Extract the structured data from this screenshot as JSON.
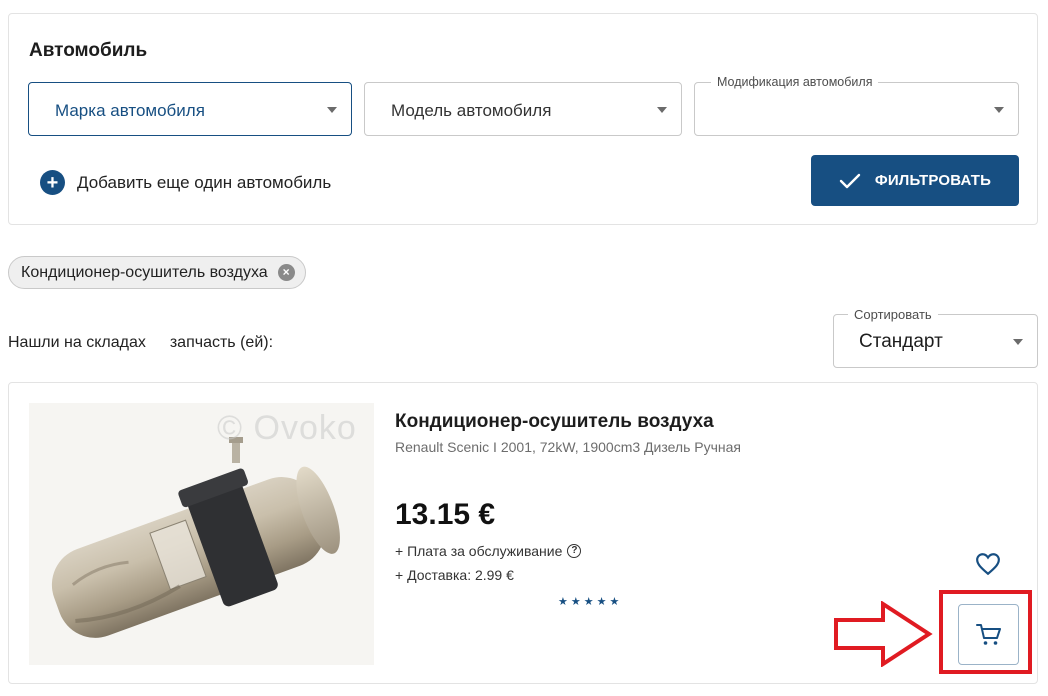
{
  "car_filter": {
    "title": "Автомобиль",
    "brand_placeholder": "Марка автомобиля",
    "model_placeholder": "Модель автомобиля",
    "modification_label": "Модификация автомобиля",
    "modification_value": "",
    "add_car_label": "Добавить еще один автомобиль",
    "filter_button_label": "ФИЛЬТРОВАТЬ"
  },
  "chip": {
    "label": "Кондиционер-осушитель воздуха"
  },
  "results": {
    "found_prefix": "Нашли на складах",
    "found_suffix": "запчасть (ей):"
  },
  "sort": {
    "label": "Сортировать",
    "value": "Стандарт"
  },
  "product": {
    "watermark": "© Ovoko",
    "title": "Кондиционер-осушитель воздуха",
    "subtitle": "Renault Scenic I 2001, 72kW, 1900cm3 Дизель Ручная",
    "price": "13.15 €",
    "service_fee": "+ Плата за обслуживание",
    "delivery": "+ Доставка: 2.99 €",
    "rating_stars": "★★★★★",
    "rating_value": 5
  },
  "colors": {
    "accent": "#174f82",
    "annotation": "#e01b22"
  },
  "icons": [
    "plus-icon",
    "check-icon",
    "close-icon",
    "help-icon",
    "heart-icon",
    "cart-icon",
    "chevron-down-icon"
  ]
}
